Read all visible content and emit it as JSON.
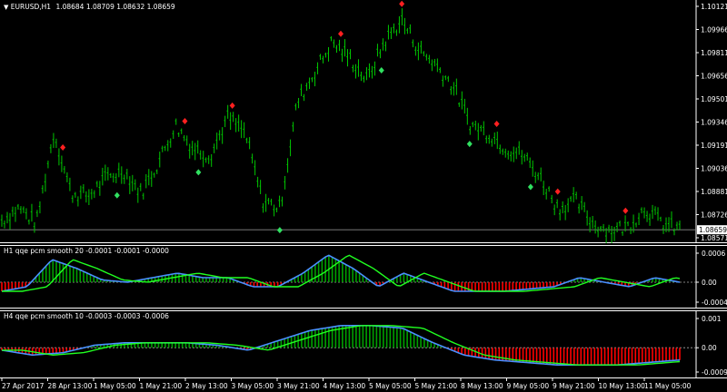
{
  "window": {
    "menu_icon": "triangle-down-icon",
    "symbol": "EURUSD,H1",
    "ohlc": "1.08684 1.08709 1.08632 1.08659"
  },
  "colors": {
    "background": "#000000",
    "candle": "#00c800",
    "diamond_up": "#30e060",
    "diamond_down": "#ff2020",
    "hist_pos": "#00a000",
    "hist_neg": "#ff0000",
    "line_blue": "#4a90ff",
    "line_green": "#20ff20"
  },
  "price_axis": {
    "ticks": [
      "1.10121",
      "1.09966",
      "1.09811",
      "1.09656",
      "1.09501",
      "1.09346",
      "1.09191",
      "1.09036",
      "1.08881",
      "1.08726",
      "1.08571"
    ],
    "current": "1.08659"
  },
  "sub1": {
    "title": "H1  qqe pcm smooth  20 -0.0001 -0.0001 -0.0000",
    "ticks": [
      "0.0006",
      "0.00",
      "-0.0004"
    ]
  },
  "sub2": {
    "title": "H4  qqe pcm smooth  10 -0.0003 -0.0003 -0.0006",
    "ticks": [
      "0.001",
      "0.00",
      "-0.0009"
    ]
  },
  "time_axis": [
    "27 Apr 2017",
    "28 Apr 13:00",
    "1 May 05:00",
    "1 May 21:00",
    "2 May 13:00",
    "3 May 05:00",
    "3 May 21:00",
    "4 May 13:00",
    "5 May 05:00",
    "5 May 21:00",
    "8 May 13:00",
    "9 May 05:00",
    "9 May 21:00",
    "10 May 13:00",
    "11 May 05:00"
  ],
  "chart_data": [
    {
      "type": "candlestick",
      "ylim": [
        1.0857,
        1.1014
      ],
      "close_approx": [
        1.0872,
        1.088,
        1.087,
        1.093,
        1.089,
        1.0888,
        1.09,
        1.0905,
        1.089,
        1.091,
        1.0935,
        1.092,
        1.0915,
        1.094,
        1.093,
        1.0885,
        1.088,
        1.095,
        1.097,
        1.099,
        1.098,
        1.0965,
        1.099,
        1.1005,
        1.0985,
        1.0975,
        1.096,
        1.0935,
        1.093,
        1.092,
        1.0915,
        1.09,
        1.088,
        1.0885,
        1.087,
        1.0865,
        1.0868,
        1.088,
        1.087,
        1.0866
      ],
      "signals_up_x": [
        0.17,
        0.29,
        0.41,
        0.56,
        0.69,
        0.78
      ],
      "signals_down_x": [
        0.09,
        0.27,
        0.34,
        0.5,
        0.59,
        0.73,
        0.82,
        0.92
      ]
    },
    {
      "type": "histogram+lines",
      "ylim": [
        -0.0005,
        0.0007
      ],
      "values": [
        -0.0002,
        -0.0001,
        0.0005,
        0.0003,
        5e-05,
        0.0,
        0.0001,
        0.0002,
        0.0001,
        0.0001,
        -0.0001,
        -0.0001,
        0.0002,
        0.0006,
        0.0003,
        -0.0001,
        0.0002,
        0.0,
        -0.0002,
        -0.0002,
        -0.0002,
        -0.00015,
        -0.0001,
        0.0001,
        0.0,
        -0.0001,
        0.0001,
        0.0
      ]
    },
    {
      "type": "histogram+lines",
      "ylim": [
        -0.0011,
        0.0013
      ],
      "values": [
        -0.0001,
        -0.0003,
        -0.0002,
        0.0001,
        0.0002,
        0.0002,
        0.0002,
        0.0001,
        -0.0001,
        0.0003,
        0.0007,
        0.0009,
        0.0009,
        0.0008,
        0.0002,
        -0.0003,
        -0.0005,
        -0.0006,
        -0.0007,
        -0.0007,
        -0.0007,
        -0.0006,
        -0.0005
      ]
    }
  ]
}
